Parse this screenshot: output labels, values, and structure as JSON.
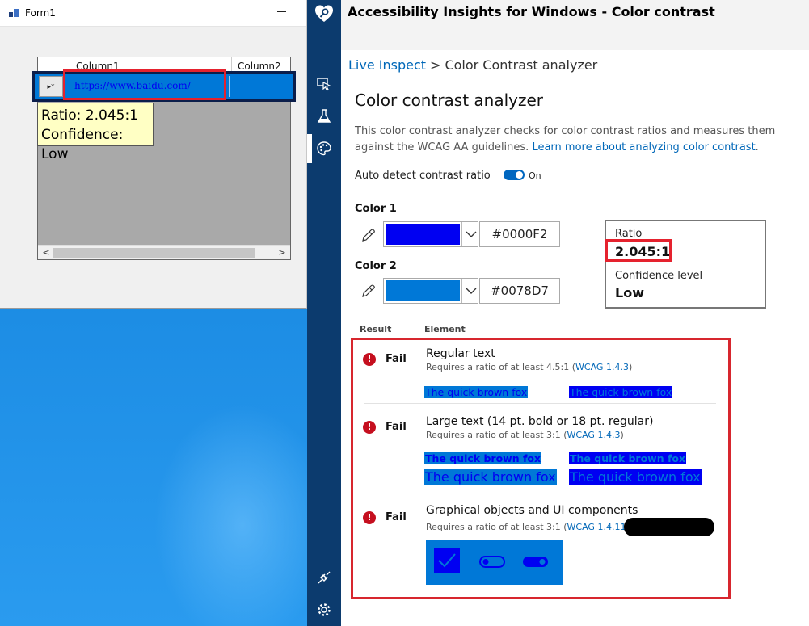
{
  "form1": {
    "title": "Form1",
    "grid": {
      "columns": [
        "Column1",
        "Column2"
      ],
      "row_header_glyph": "▸*",
      "cell_link": "https://www.baidu.com/"
    },
    "tooltip": {
      "ratio_line": "Ratio: 2.045:1",
      "confidence_line": "Confidence: Low"
    },
    "scroll_left": "<",
    "scroll_right": ">"
  },
  "app": {
    "title": "Accessibility Insights for Windows - Color contrast",
    "breadcrumb": {
      "live": "Live Inspect",
      "separator": ">",
      "current": "Color Contrast analyzer"
    },
    "page_title": "Color contrast analyzer",
    "intro_text": "This color contrast analyzer checks for color contrast ratios and measures them against the WCAG AA guidelines.",
    "learn_more": "Learn more about analyzing color contrast",
    "learn_more_suffix": ".",
    "auto_detect_label": "Auto detect contrast ratio",
    "auto_detect_state": "On",
    "color1": {
      "label": "Color 1",
      "hex": "#0000F2",
      "swatch": "#0000f2"
    },
    "color2": {
      "label": "Color 2",
      "hex": "#0078D7",
      "swatch": "#0078d7"
    },
    "ratio": {
      "label": "Ratio",
      "value": "2.045:1",
      "confidence_label": "Confidence level",
      "confidence_value": "Low"
    },
    "results_header": {
      "result": "Result",
      "element": "Element"
    },
    "tests": [
      {
        "status": "Fail",
        "title": "Regular text",
        "requirement": "Requires a ratio of at least 4.5:1 (",
        "wcag": "WCAG 1.4.3",
        "requirement_suffix": ")",
        "samples": [
          "The quick brown fox",
          "The quick brown fox"
        ]
      },
      {
        "status": "Fail",
        "title": "Large text (14 pt. bold or 18 pt. regular)",
        "requirement": "Requires a ratio of at least 3:1 (",
        "wcag": "WCAG 1.4.3",
        "requirement_suffix": ")",
        "samples": [
          "The quick brown fox",
          "The quick brown fox",
          "The quick brown fox",
          "The quick brown fox"
        ]
      },
      {
        "status": "Fail",
        "title": "Graphical objects and UI components",
        "requirement": "Requires a ratio of at least 3:1 (",
        "wcag": "WCAG 1.4.11",
        "requirement_suffix": ")"
      }
    ],
    "fail_glyph": "!"
  },
  "colors": {
    "rail": "#0c3b6e",
    "accent": "#0067b8",
    "fail": "#c50f1f",
    "highlight": "#e5222e"
  },
  "icons": {
    "rail_logo": "accessibility-insights-logo-icon",
    "rail_items": [
      "live-inspect-icon",
      "test-flask-icon",
      "color-contrast-palette-icon"
    ],
    "rail_bottom": [
      "connection-plug-icon",
      "settings-gear-icon"
    ]
  }
}
